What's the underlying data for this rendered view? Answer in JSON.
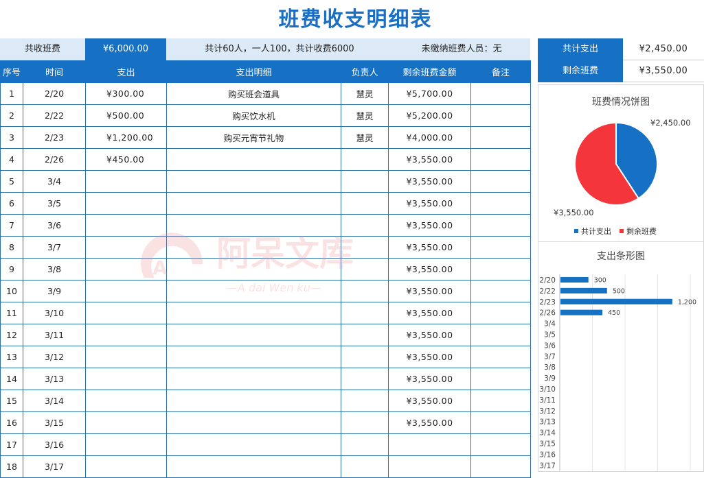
{
  "title": "班费收支明细表",
  "summary": {
    "label": "共收班费",
    "value": "¥6,000.00",
    "description": "共计60人，一人100，共计收费6000",
    "unpaid": "未缴纳班费人员：无"
  },
  "columns": [
    "序号",
    "时间",
    "支出",
    "支出明细",
    "负责人",
    "剩余班费金额",
    "备注"
  ],
  "rows": [
    {
      "no": "1",
      "date": "2/20",
      "expense": "¥300.00",
      "detail": "购买班会道具",
      "person": "慧灵",
      "balance": "¥5,700.00",
      "note": ""
    },
    {
      "no": "2",
      "date": "2/22",
      "expense": "¥500.00",
      "detail": "购买饮水机",
      "person": "慧灵",
      "balance": "¥5,200.00",
      "note": ""
    },
    {
      "no": "3",
      "date": "2/23",
      "expense": "¥1,200.00",
      "detail": "购买元宵节礼物",
      "person": "慧灵",
      "balance": "¥4,000.00",
      "note": ""
    },
    {
      "no": "4",
      "date": "2/26",
      "expense": "¥450.00",
      "detail": "",
      "person": "",
      "balance": "¥3,550.00",
      "note": ""
    },
    {
      "no": "5",
      "date": "3/4",
      "expense": "",
      "detail": "",
      "person": "",
      "balance": "¥3,550.00",
      "note": ""
    },
    {
      "no": "6",
      "date": "3/5",
      "expense": "",
      "detail": "",
      "person": "",
      "balance": "¥3,550.00",
      "note": ""
    },
    {
      "no": "7",
      "date": "3/6",
      "expense": "",
      "detail": "",
      "person": "",
      "balance": "¥3,550.00",
      "note": ""
    },
    {
      "no": "8",
      "date": "3/7",
      "expense": "",
      "detail": "",
      "person": "",
      "balance": "¥3,550.00",
      "note": ""
    },
    {
      "no": "9",
      "date": "3/8",
      "expense": "",
      "detail": "",
      "person": "",
      "balance": "¥3,550.00",
      "note": ""
    },
    {
      "no": "10",
      "date": "3/9",
      "expense": "",
      "detail": "",
      "person": "",
      "balance": "¥3,550.00",
      "note": ""
    },
    {
      "no": "11",
      "date": "3/10",
      "expense": "",
      "detail": "",
      "person": "",
      "balance": "¥3,550.00",
      "note": ""
    },
    {
      "no": "12",
      "date": "3/11",
      "expense": "",
      "detail": "",
      "person": "",
      "balance": "¥3,550.00",
      "note": ""
    },
    {
      "no": "13",
      "date": "3/12",
      "expense": "",
      "detail": "",
      "person": "",
      "balance": "¥3,550.00",
      "note": ""
    },
    {
      "no": "14",
      "date": "3/13",
      "expense": "",
      "detail": "",
      "person": "",
      "balance": "¥3,550.00",
      "note": ""
    },
    {
      "no": "15",
      "date": "3/14",
      "expense": "",
      "detail": "",
      "person": "",
      "balance": "¥3,550.00",
      "note": ""
    },
    {
      "no": "16",
      "date": "3/15",
      "expense": "",
      "detail": "",
      "person": "",
      "balance": "¥3,550.00",
      "note": ""
    },
    {
      "no": "17",
      "date": "3/16",
      "expense": "",
      "detail": "",
      "person": "",
      "balance": "",
      "note": ""
    },
    {
      "no": "18",
      "date": "3/17",
      "expense": "",
      "detail": "",
      "person": "",
      "balance": "",
      "note": ""
    }
  ],
  "right_summary": {
    "total_expense_label": "共计支出",
    "total_expense_value": "¥2,450.00",
    "remaining_label": "剩余班费",
    "remaining_value": "¥3,550.00"
  },
  "watermark": {
    "text": "阿呆文库",
    "subtext": "—A dai Wen ku—"
  },
  "colors": {
    "accent": "#1670c4",
    "pie_expense": "#1670c4",
    "pie_remaining": "#f5353c",
    "title": "#1a6fc4"
  },
  "chart_data": [
    {
      "type": "pie",
      "title": "班费情况饼图",
      "categories": [
        "共计支出",
        "剩余班费"
      ],
      "values": [
        2450,
        3550
      ],
      "labels": [
        "¥2,450.00",
        "¥3,550.00"
      ],
      "legend": "bottom"
    },
    {
      "type": "bar",
      "orientation": "horizontal",
      "title": "支出条形图",
      "categories": [
        "2/20",
        "2/22",
        "2/23",
        "2/26",
        "3/4",
        "3/5",
        "3/6",
        "3/7",
        "3/8",
        "3/9",
        "3/10",
        "3/11",
        "3/12",
        "3/13",
        "3/14",
        "3/15",
        "3/16",
        "3/17"
      ],
      "values": [
        300,
        500,
        1200,
        450,
        null,
        null,
        null,
        null,
        null,
        null,
        null,
        null,
        null,
        null,
        null,
        null,
        null,
        null
      ],
      "value_labels": [
        "300",
        "500",
        "1,200",
        "450"
      ],
      "xlim": [
        0,
        1400
      ],
      "grid": true
    }
  ]
}
